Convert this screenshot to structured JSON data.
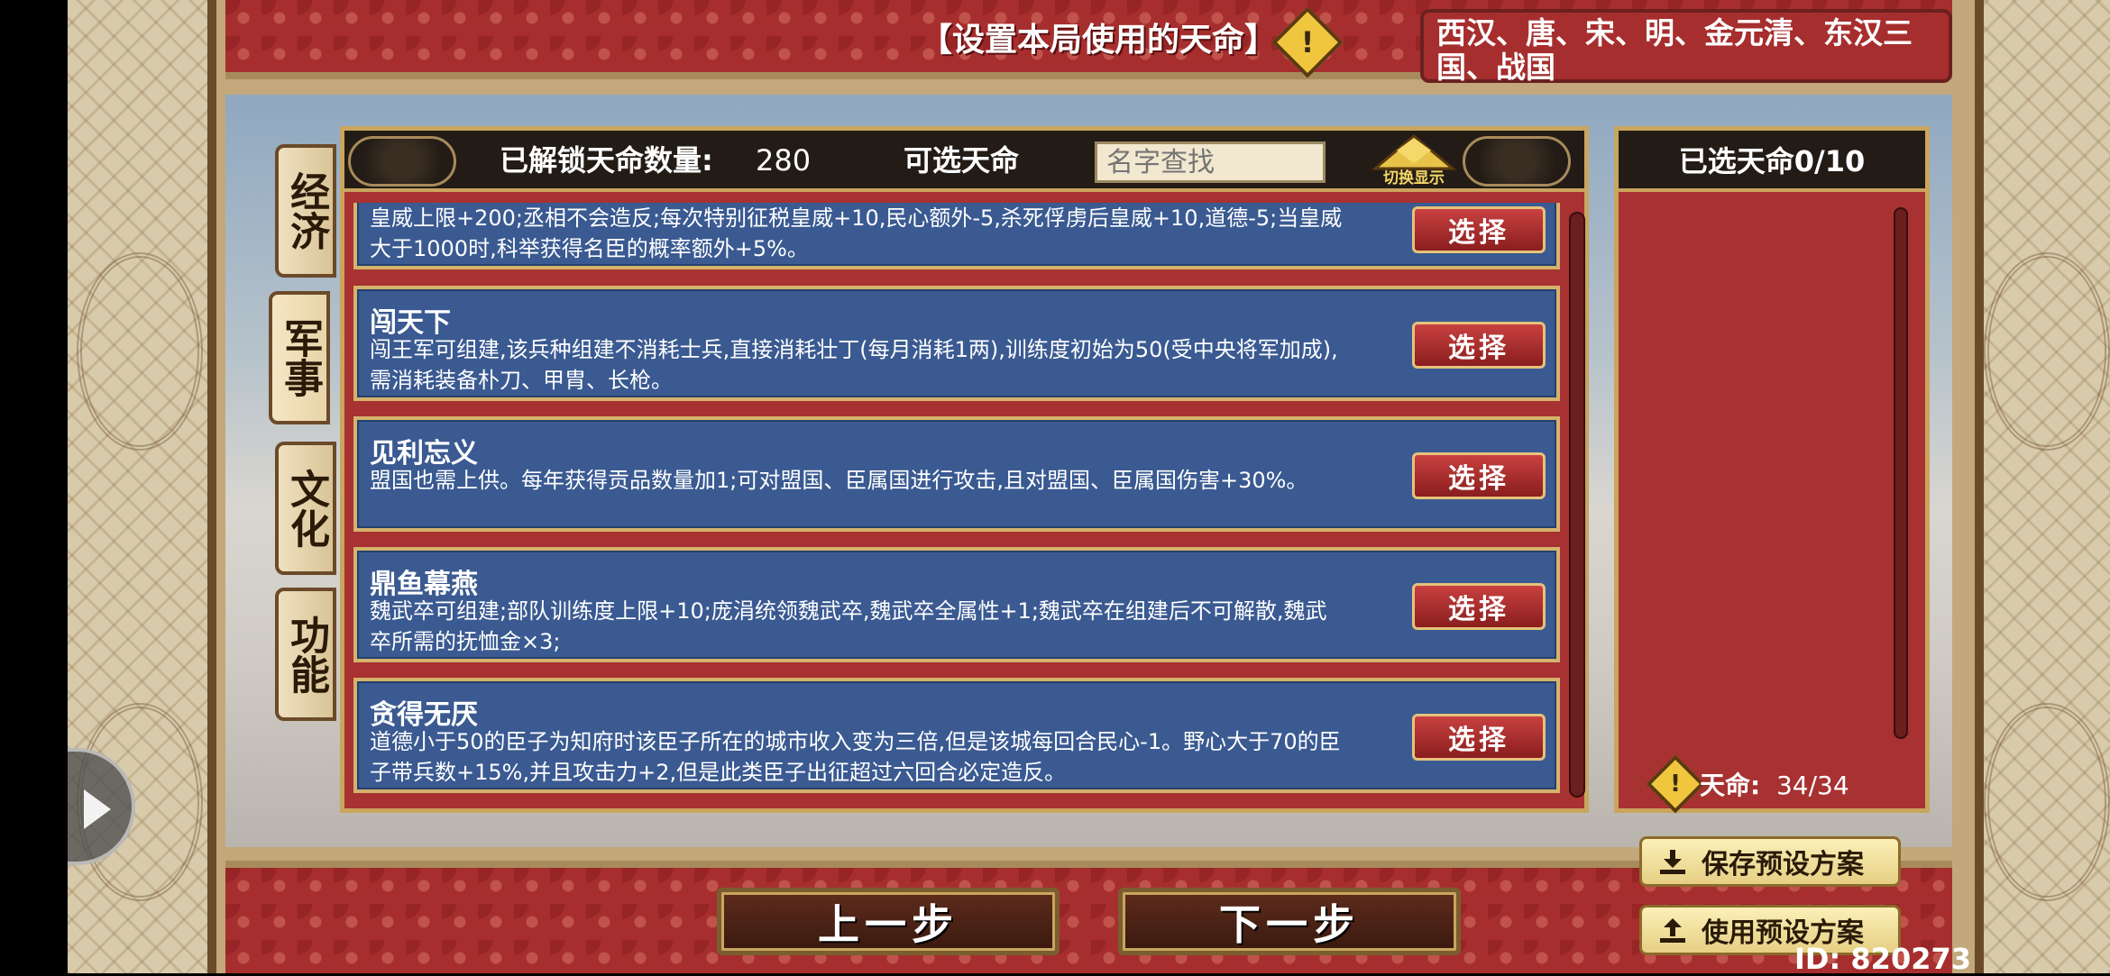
{
  "header": {
    "title": "【设置本局使用的天命】",
    "dynasties": "西汉、唐、宋、明、金元清、东汉三国、战国"
  },
  "categories": [
    {
      "label": "经济",
      "active": false
    },
    {
      "label": "军事",
      "active": true
    },
    {
      "label": "文化",
      "active": false
    },
    {
      "label": "功能",
      "active": false
    }
  ],
  "available": {
    "unlocked_label": "已解锁天命数量:",
    "unlocked_count": "280",
    "selectable_label": "可选天命",
    "search_placeholder": "名字查找",
    "toggle_label": "切换显示"
  },
  "entries": [
    {
      "name": "",
      "desc": "皇威上限+200;丞相不会造反;每次特别征税皇威+10,民心额外-5,杀死俘虏后皇威+10,道德-5;当皇威大于1000时,科举获得名臣的概率额外+5%。",
      "button": "选择"
    },
    {
      "name": "闯天下",
      "desc": "闯王军可组建,该兵种组建不消耗士兵,直接消耗壮丁(每月消耗1两),训练度初始为50(受中央将军加成),需消耗装备朴刀、甲胄、长枪。",
      "button": "选择"
    },
    {
      "name": "见利忘义",
      "desc": "盟国也需上供。每年获得贡品数量加1;可对盟国、臣属国进行攻击,且对盟国、臣属国伤害+30%。",
      "button": "选择"
    },
    {
      "name": "鼎鱼幕燕",
      "desc": "魏武卒可组建;部队训练度上限+10;庞涓统领魏武卒,魏武卒全属性+1;魏武卒在组建后不可解散,魏武卒所需的抚恤金×3;",
      "button": "选择"
    },
    {
      "name": "贪得无厌",
      "desc": "道德小于50的臣子为知府时该臣子所在的城市收入变为三倍,但是该城每回合民心-1。野心大于70的臣子带兵数+15%,并且攻击力+2,但是此类臣子出征超过六回合必定造反。",
      "button": "选择"
    }
  ],
  "selected": {
    "title": "已选天命0/10",
    "footer_label": "天命:",
    "footer_value": "34/34"
  },
  "nav": {
    "prev": "上一步",
    "next": "下一步"
  },
  "presets": {
    "save": "保存预设方案",
    "use": "使用预设方案"
  },
  "id_text": "ID: 820273"
}
